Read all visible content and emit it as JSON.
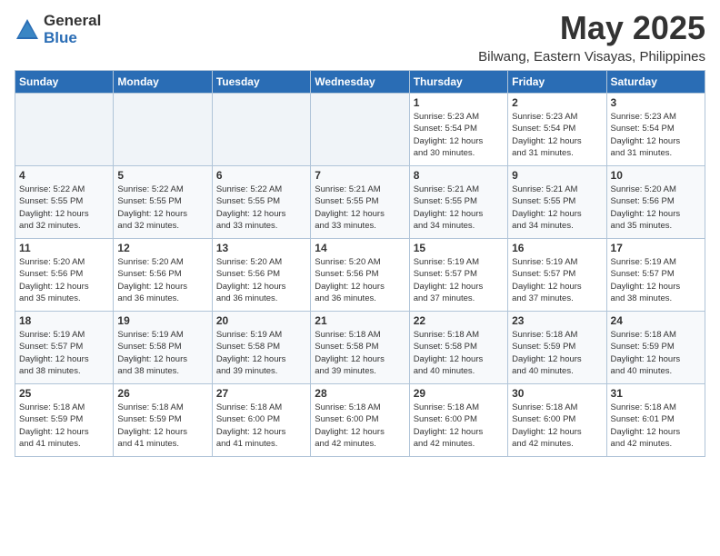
{
  "logo": {
    "general": "General",
    "blue": "Blue"
  },
  "title": "May 2025",
  "subtitle": "Bilwang, Eastern Visayas, Philippines",
  "weekdays": [
    "Sunday",
    "Monday",
    "Tuesday",
    "Wednesday",
    "Thursday",
    "Friday",
    "Saturday"
  ],
  "weeks": [
    [
      {
        "day": "",
        "info": ""
      },
      {
        "day": "",
        "info": ""
      },
      {
        "day": "",
        "info": ""
      },
      {
        "day": "",
        "info": ""
      },
      {
        "day": "1",
        "info": "Sunrise: 5:23 AM\nSunset: 5:54 PM\nDaylight: 12 hours\nand 30 minutes."
      },
      {
        "day": "2",
        "info": "Sunrise: 5:23 AM\nSunset: 5:54 PM\nDaylight: 12 hours\nand 31 minutes."
      },
      {
        "day": "3",
        "info": "Sunrise: 5:23 AM\nSunset: 5:54 PM\nDaylight: 12 hours\nand 31 minutes."
      }
    ],
    [
      {
        "day": "4",
        "info": "Sunrise: 5:22 AM\nSunset: 5:55 PM\nDaylight: 12 hours\nand 32 minutes."
      },
      {
        "day": "5",
        "info": "Sunrise: 5:22 AM\nSunset: 5:55 PM\nDaylight: 12 hours\nand 32 minutes."
      },
      {
        "day": "6",
        "info": "Sunrise: 5:22 AM\nSunset: 5:55 PM\nDaylight: 12 hours\nand 33 minutes."
      },
      {
        "day": "7",
        "info": "Sunrise: 5:21 AM\nSunset: 5:55 PM\nDaylight: 12 hours\nand 33 minutes."
      },
      {
        "day": "8",
        "info": "Sunrise: 5:21 AM\nSunset: 5:55 PM\nDaylight: 12 hours\nand 34 minutes."
      },
      {
        "day": "9",
        "info": "Sunrise: 5:21 AM\nSunset: 5:55 PM\nDaylight: 12 hours\nand 34 minutes."
      },
      {
        "day": "10",
        "info": "Sunrise: 5:20 AM\nSunset: 5:56 PM\nDaylight: 12 hours\nand 35 minutes."
      }
    ],
    [
      {
        "day": "11",
        "info": "Sunrise: 5:20 AM\nSunset: 5:56 PM\nDaylight: 12 hours\nand 35 minutes."
      },
      {
        "day": "12",
        "info": "Sunrise: 5:20 AM\nSunset: 5:56 PM\nDaylight: 12 hours\nand 36 minutes."
      },
      {
        "day": "13",
        "info": "Sunrise: 5:20 AM\nSunset: 5:56 PM\nDaylight: 12 hours\nand 36 minutes."
      },
      {
        "day": "14",
        "info": "Sunrise: 5:20 AM\nSunset: 5:56 PM\nDaylight: 12 hours\nand 36 minutes."
      },
      {
        "day": "15",
        "info": "Sunrise: 5:19 AM\nSunset: 5:57 PM\nDaylight: 12 hours\nand 37 minutes."
      },
      {
        "day": "16",
        "info": "Sunrise: 5:19 AM\nSunset: 5:57 PM\nDaylight: 12 hours\nand 37 minutes."
      },
      {
        "day": "17",
        "info": "Sunrise: 5:19 AM\nSunset: 5:57 PM\nDaylight: 12 hours\nand 38 minutes."
      }
    ],
    [
      {
        "day": "18",
        "info": "Sunrise: 5:19 AM\nSunset: 5:57 PM\nDaylight: 12 hours\nand 38 minutes."
      },
      {
        "day": "19",
        "info": "Sunrise: 5:19 AM\nSunset: 5:58 PM\nDaylight: 12 hours\nand 38 minutes."
      },
      {
        "day": "20",
        "info": "Sunrise: 5:19 AM\nSunset: 5:58 PM\nDaylight: 12 hours\nand 39 minutes."
      },
      {
        "day": "21",
        "info": "Sunrise: 5:18 AM\nSunset: 5:58 PM\nDaylight: 12 hours\nand 39 minutes."
      },
      {
        "day": "22",
        "info": "Sunrise: 5:18 AM\nSunset: 5:58 PM\nDaylight: 12 hours\nand 40 minutes."
      },
      {
        "day": "23",
        "info": "Sunrise: 5:18 AM\nSunset: 5:59 PM\nDaylight: 12 hours\nand 40 minutes."
      },
      {
        "day": "24",
        "info": "Sunrise: 5:18 AM\nSunset: 5:59 PM\nDaylight: 12 hours\nand 40 minutes."
      }
    ],
    [
      {
        "day": "25",
        "info": "Sunrise: 5:18 AM\nSunset: 5:59 PM\nDaylight: 12 hours\nand 41 minutes."
      },
      {
        "day": "26",
        "info": "Sunrise: 5:18 AM\nSunset: 5:59 PM\nDaylight: 12 hours\nand 41 minutes."
      },
      {
        "day": "27",
        "info": "Sunrise: 5:18 AM\nSunset: 6:00 PM\nDaylight: 12 hours\nand 41 minutes."
      },
      {
        "day": "28",
        "info": "Sunrise: 5:18 AM\nSunset: 6:00 PM\nDaylight: 12 hours\nand 42 minutes."
      },
      {
        "day": "29",
        "info": "Sunrise: 5:18 AM\nSunset: 6:00 PM\nDaylight: 12 hours\nand 42 minutes."
      },
      {
        "day": "30",
        "info": "Sunrise: 5:18 AM\nSunset: 6:00 PM\nDaylight: 12 hours\nand 42 minutes."
      },
      {
        "day": "31",
        "info": "Sunrise: 5:18 AM\nSunset: 6:01 PM\nDaylight: 12 hours\nand 42 minutes."
      }
    ]
  ]
}
